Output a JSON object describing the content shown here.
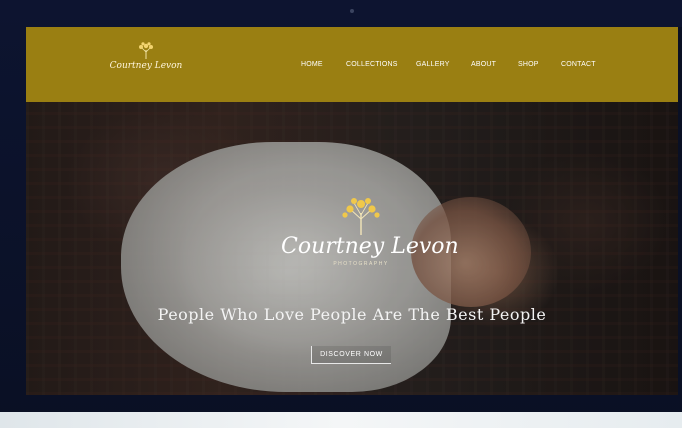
{
  "brand": {
    "name": "Courtney Levon",
    "tagline_small": "PHOTOGRAPHY",
    "accent_color": "#9a7f12"
  },
  "nav": {
    "items": [
      {
        "label": "HOME"
      },
      {
        "label": "COLLECTIONS"
      },
      {
        "label": "GALLERY"
      },
      {
        "label": "ABOUT"
      },
      {
        "label": "SHOP"
      },
      {
        "label": "CONTACT"
      }
    ]
  },
  "hero": {
    "title": "Courtney Levon",
    "subtitle": "PHOTOGRAPHY",
    "tagline": "People Who Love People Are The Best People",
    "cta_label": "DISCOVER NOW",
    "image": "newborn-in-white-blanket"
  },
  "icons": {
    "logo": "tree-icon"
  }
}
